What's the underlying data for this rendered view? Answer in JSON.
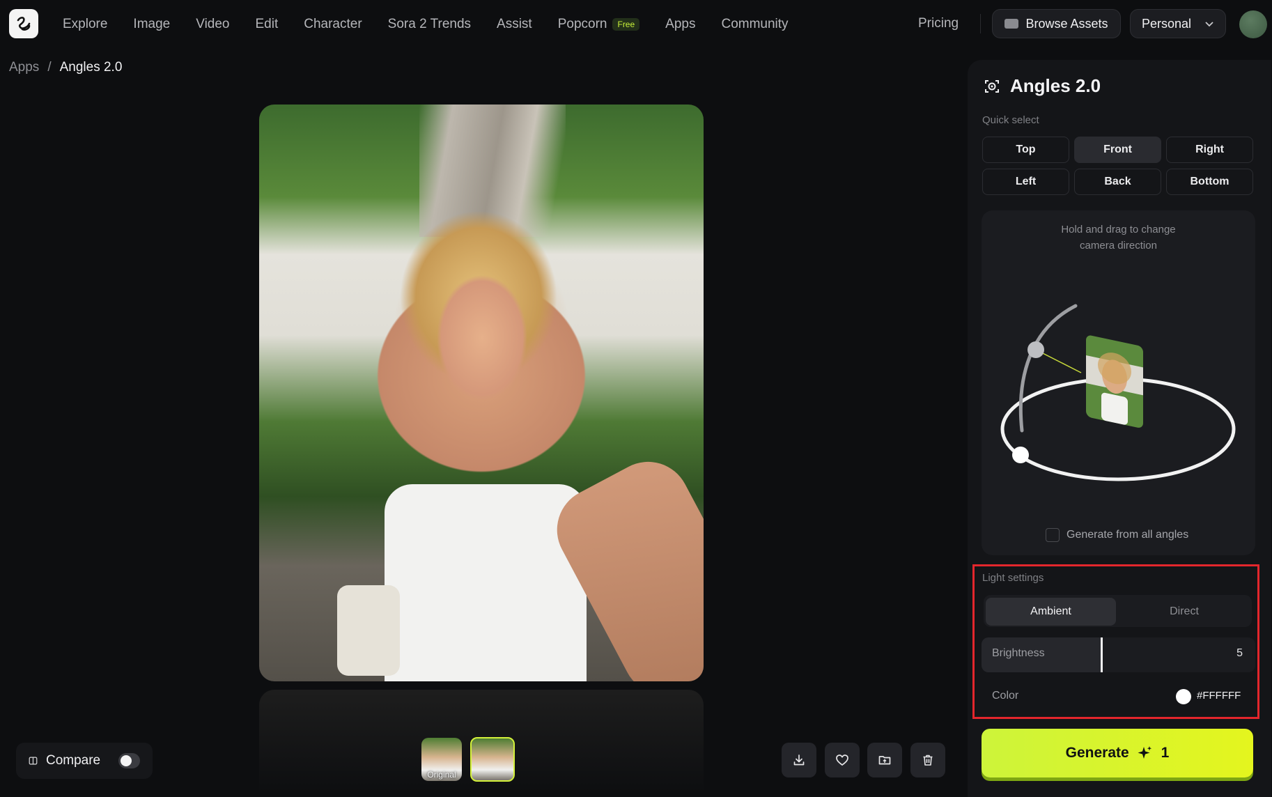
{
  "nav": {
    "items": [
      "Explore",
      "Image",
      "Video",
      "Edit",
      "Character",
      "Sora 2 Trends",
      "Assist",
      "Popcorn",
      "Apps",
      "Community"
    ],
    "popcorn_badge": "Free",
    "pricing": "Pricing",
    "browse_assets": "Browse Assets",
    "workspace": "Personal"
  },
  "breadcrumb": {
    "parent": "Apps",
    "separator": "/",
    "current": "Angles 2.0"
  },
  "panel": {
    "title": "Angles 2.0",
    "quick_select_label": "Quick select",
    "quick_select": [
      "Top",
      "Front",
      "Right",
      "Left",
      "Back",
      "Bottom"
    ],
    "quick_select_active": "Front",
    "viewer_hint_line1": "Hold and drag to change",
    "viewer_hint_line2": "camera direction",
    "generate_all_label": "Generate from all angles",
    "light_settings_label": "Light settings",
    "light_modes": [
      "Ambient",
      "Direct"
    ],
    "light_mode_active": "Ambient",
    "brightness_label": "Brightness",
    "brightness_value": "5",
    "color_label": "Color",
    "color_value": "#FFFFFF",
    "generate_label": "Generate",
    "generate_cost": "1"
  },
  "footer": {
    "compare_label": "Compare",
    "thumb_original_label": "Original"
  },
  "colors": {
    "accent": "#d4f23a",
    "highlight": "#e3262c",
    "background": "#0d0e10"
  }
}
